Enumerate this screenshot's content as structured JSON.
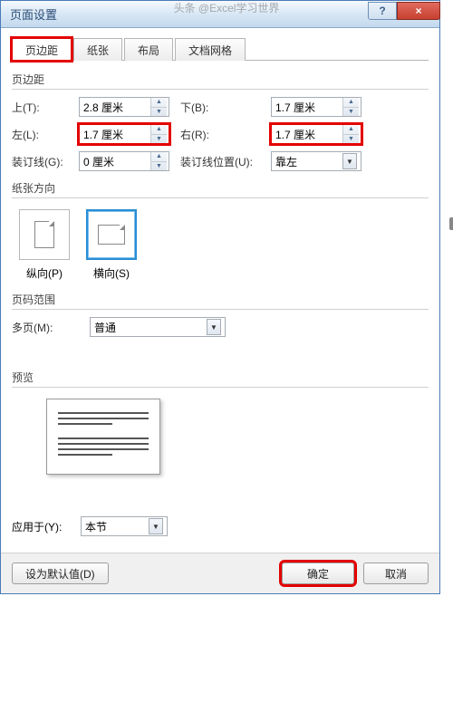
{
  "window": {
    "title": "页面设置",
    "help": "?",
    "close": "×"
  },
  "tabs": {
    "margins": "页边距",
    "paper": "纸张",
    "layout": "布局",
    "grid": "文档网格"
  },
  "margins": {
    "group": "页边距",
    "top_label": "上(T):",
    "top_value": "2.8 厘米",
    "bottom_label": "下(B):",
    "bottom_value": "1.7 厘米",
    "left_label": "左(L):",
    "left_value": "1.7 厘米",
    "right_label": "右(R):",
    "right_value": "1.7 厘米",
    "gutter_label": "装订线(G):",
    "gutter_value": "0 厘米",
    "gutter_pos_label": "装订线位置(U):",
    "gutter_pos_value": "靠左"
  },
  "orientation": {
    "group": "纸张方向",
    "portrait": "纵向(P)",
    "landscape": "横向(S)"
  },
  "pages": {
    "group": "页码范围",
    "multi_label": "多页(M):",
    "multi_value": "普通"
  },
  "preview": {
    "group": "预览"
  },
  "apply": {
    "label": "应用于(Y):",
    "value": "本节"
  },
  "buttons": {
    "default": "设为默认值(D)",
    "ok": "确定",
    "cancel": "取消"
  },
  "watermark": "头条 @Excel学习世界"
}
